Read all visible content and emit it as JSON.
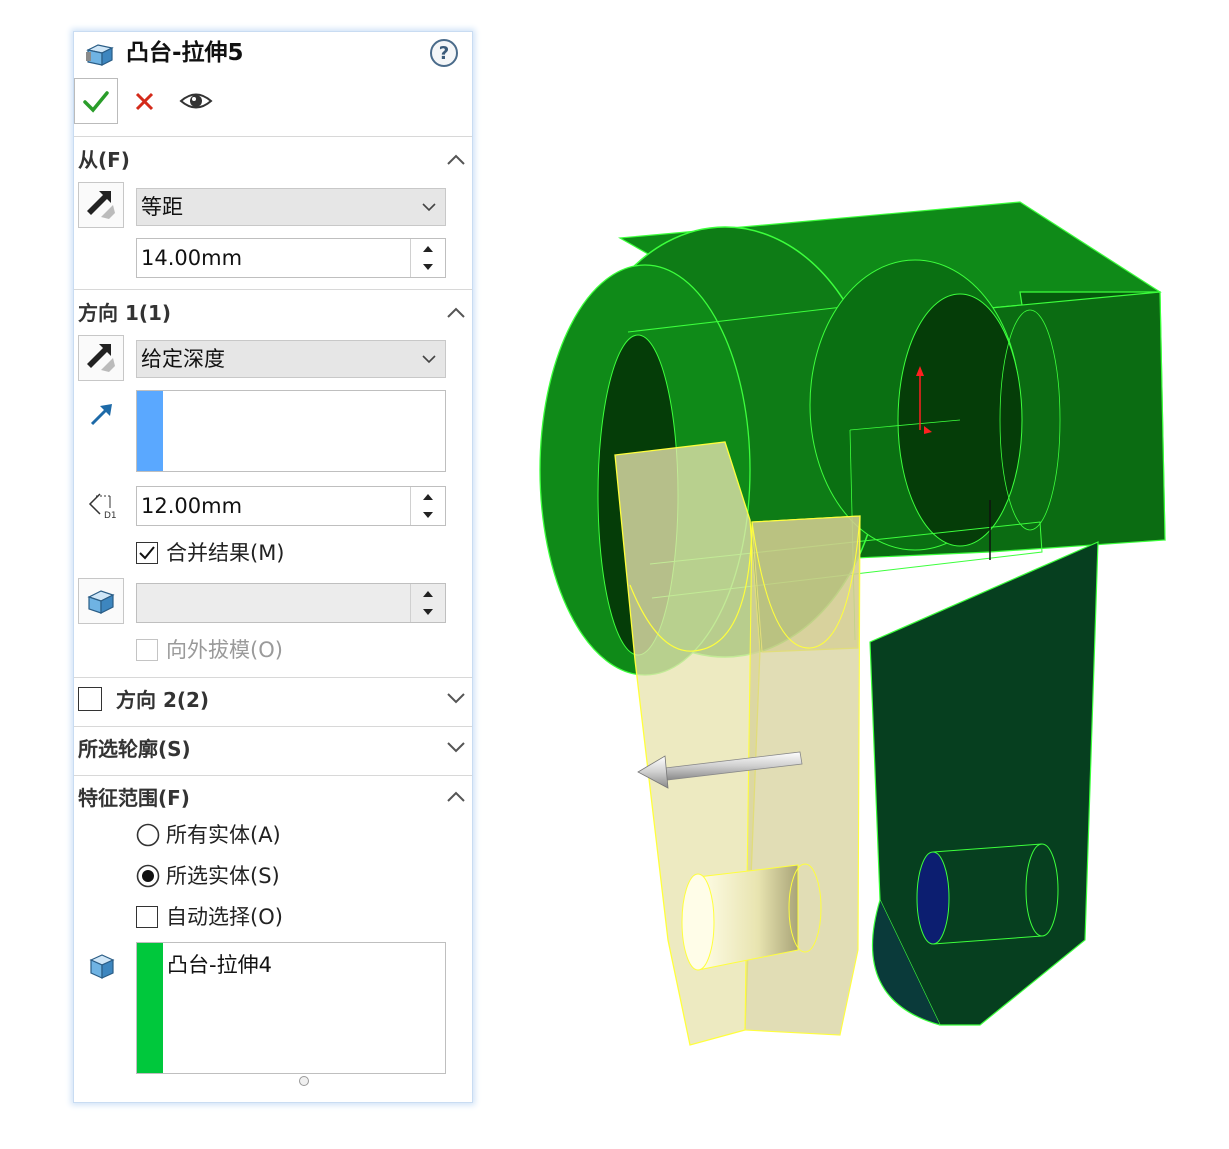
{
  "panel": {
    "title": "凸台-拉伸5",
    "icons": {
      "feature": "extrude-feature-icon",
      "help": "help-icon",
      "ok": "check-icon",
      "cancel": "close-icon",
      "preview": "eye-icon"
    },
    "colors": {
      "ok": "#2a9d2a",
      "cancel": "#d42a1a",
      "accent_blue": "#5aa8ff",
      "accent_green": "#00c83c"
    }
  },
  "from": {
    "title": "从(F)",
    "condition": "等距",
    "offset_value": "14.00mm"
  },
  "direction1": {
    "title": "方向 1(1)",
    "end_condition": "给定深度",
    "depth_value": "12.00mm",
    "merge_result": {
      "label": "合并结果(M)",
      "checked": true
    },
    "draft_value": "",
    "draft_outward": {
      "label": "向外拔模(O)",
      "checked": false,
      "disabled": true
    }
  },
  "direction2": {
    "title": "方向 2(2)",
    "checked": false
  },
  "selected_contours": {
    "title": "所选轮廓(S)"
  },
  "feature_scope": {
    "title": "特征范围(F)",
    "options": [
      {
        "label": "所有实体(A)",
        "selected": false
      },
      {
        "label": "所选实体(S)",
        "selected": true
      }
    ],
    "auto_select": {
      "label": "自动选择(O)",
      "checked": false
    },
    "bodies": [
      "凸台-拉伸4"
    ]
  },
  "viewport": {
    "model_color": "#0a6e12",
    "edge_color": "#3cff3c",
    "preview_color": "#e8e4b0",
    "preview_edge_color": "#ffff3c"
  }
}
